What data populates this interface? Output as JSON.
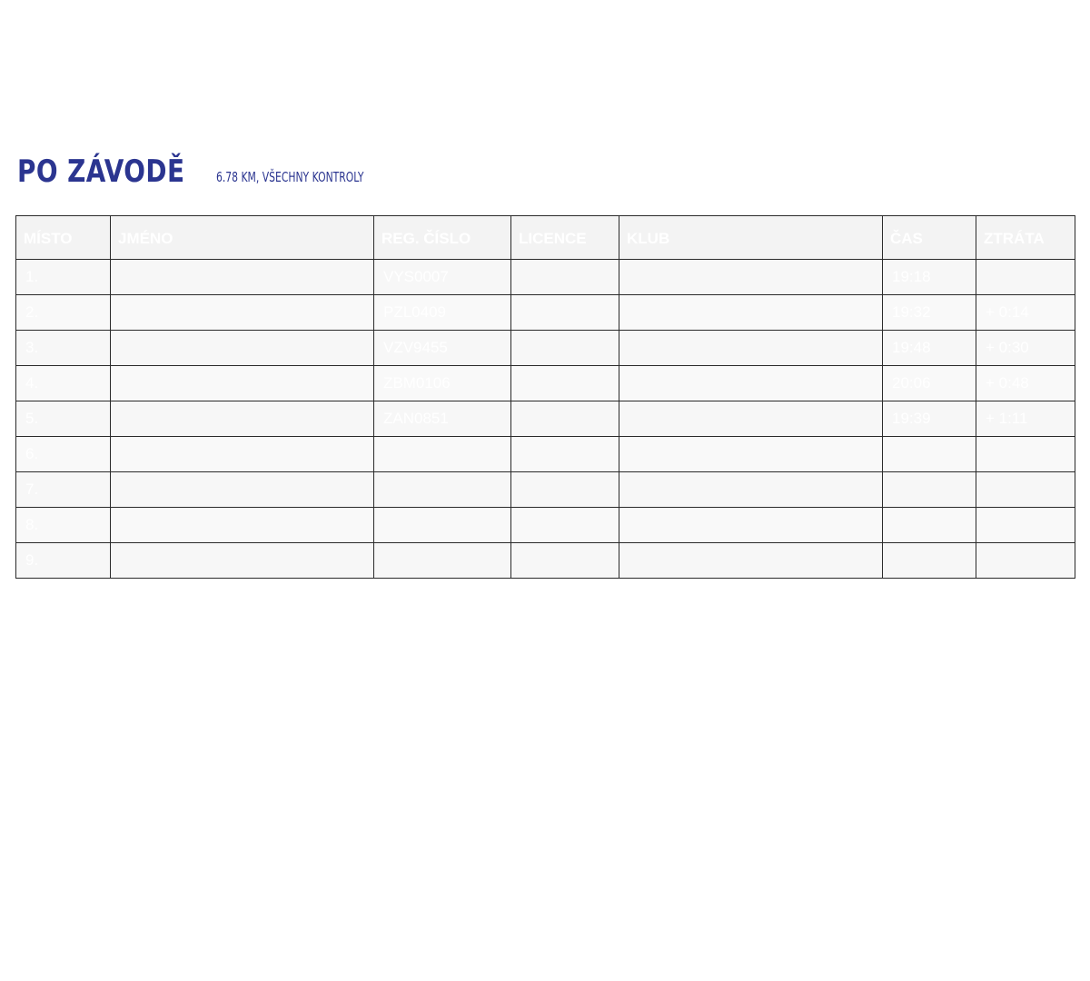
{
  "header": {
    "title": "PO ZÁVODĚ",
    "subtitle": "6.78 KM, VŠECHNY KONTROLY"
  },
  "table": {
    "columns": [
      "MÍSTO",
      "JMÉNO",
      "REG. ČÍSLO",
      "LICENCE",
      "KLUB",
      "ČAS",
      "ZTRÁTA"
    ],
    "rows": [
      {
        "place": "1.",
        "name": "",
        "reg": "VYS0007",
        "licence": "",
        "club": "",
        "time": "19:18",
        "loss": ""
      },
      {
        "place": "2.",
        "name": "",
        "reg": "PZL0409",
        "licence": "",
        "club": "",
        "time": "19:32",
        "loss": "+ 0:14"
      },
      {
        "place": "3.",
        "name": "",
        "reg": "VZV9455",
        "licence": "",
        "club": "",
        "time": "19:48",
        "loss": "+ 0:30"
      },
      {
        "place": "4.",
        "name": "",
        "reg": "ZBM0106",
        "licence": "",
        "club": "",
        "time": "20:06",
        "loss": "+ 0:48"
      },
      {
        "place": "5.",
        "name": "",
        "reg": "ZAN0851",
        "licence": "",
        "club": "",
        "time": "19:39",
        "loss": "+ 1:11"
      },
      {
        "place": "6.",
        "name": "",
        "reg": "",
        "licence": "",
        "club": "",
        "time": "",
        "loss": ""
      },
      {
        "place": "7.",
        "name": "",
        "reg": "",
        "licence": "",
        "club": "",
        "time": "",
        "loss": ""
      },
      {
        "place": "8.",
        "name": "",
        "reg": "",
        "licence": "",
        "club": "",
        "time": "",
        "loss": ""
      },
      {
        "place": "9.",
        "name": "",
        "reg": "",
        "licence": "",
        "club": "",
        "time": "",
        "loss": ""
      }
    ]
  },
  "colors": {
    "title": "#2b3590",
    "border": "#2a2a2a",
    "cell_background": "#f7f7f7",
    "text": "#ffffff"
  }
}
